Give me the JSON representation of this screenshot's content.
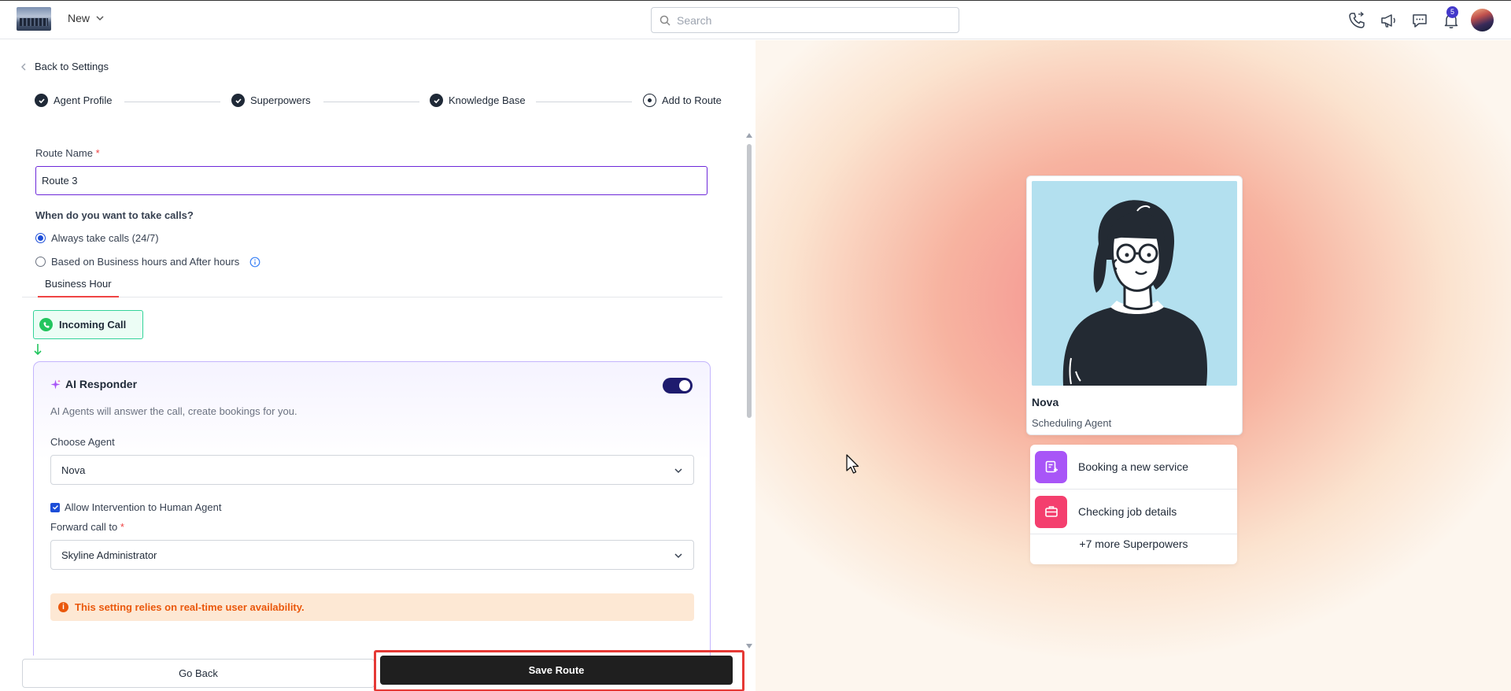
{
  "topbar": {
    "new_label": "New",
    "search_placeholder": "Search",
    "notification_count": "5",
    "icons": [
      "phone-icon",
      "megaphone-icon",
      "chat-icon",
      "bell-icon"
    ]
  },
  "nav": {
    "back_label": "Back to Settings"
  },
  "stepper": {
    "steps": [
      {
        "label": "Agent Profile",
        "state": "done"
      },
      {
        "label": "Superpowers",
        "state": "done"
      },
      {
        "label": "Knowledge Base",
        "state": "done"
      },
      {
        "label": "Add to Route",
        "state": "current"
      }
    ]
  },
  "form": {
    "route_name_label": "Route Name",
    "required_mark": "*",
    "route_name_value": "Route 3",
    "question": "When do you want to take calls?",
    "options": [
      {
        "label": "Always take calls (24/7)",
        "selected": true
      },
      {
        "label": "Based on Business hours and After hours",
        "selected": false
      }
    ],
    "tab_label": "Business Hour",
    "incoming_label": "Incoming Call",
    "ai": {
      "title": "AI Responder",
      "enabled": true,
      "description": "AI Agents will answer the call, create bookings for you.",
      "choose_agent_label": "Choose Agent",
      "agent_value": "Nova",
      "intervention_label": "Allow Intervention to Human Agent",
      "intervention_checked": true,
      "forward_label": "Forward call to",
      "forward_value": "Skyline Administrator",
      "warning": "This setting relies on real-time user availability."
    }
  },
  "actions": {
    "back_label": "Go Back",
    "save_label": "Save Route"
  },
  "agent_preview": {
    "name": "Nova",
    "role": "Scheduling Agent",
    "superpowers": [
      {
        "label": "Booking a new service",
        "color": "#a855f7",
        "icon": "calendar-plus-icon"
      },
      {
        "label": "Checking job details",
        "color": "#f43f6e",
        "icon": "briefcase-icon"
      }
    ],
    "more_label": "+7 more Superpowers"
  },
  "colors": {
    "accent": "#6d28d9",
    "toggle": "#1e1b6e",
    "success": "#22c55e",
    "warning": "#ea580c",
    "highlight": "#e53935"
  }
}
